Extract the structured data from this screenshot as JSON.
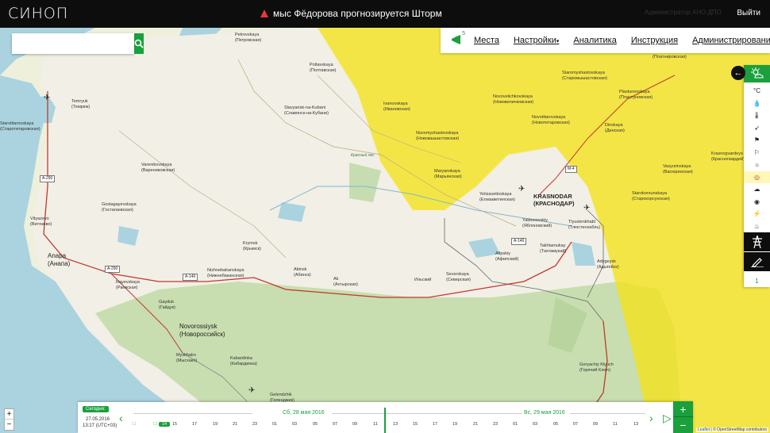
{
  "app": {
    "logo": "СИНОП",
    "alert_text": "мыс Фёдорова прогнозируется Шторм",
    "ghost_text": "Администратор АНО ДПО",
    "logout_label": "Выйти"
  },
  "search": {
    "placeholder": ""
  },
  "nav": {
    "notif_count": "5",
    "items": [
      "Места",
      "Настройки",
      "Аналитика",
      "Инструкция",
      "Администрирование"
    ],
    "dropdown_caret": "▾"
  },
  "panel": {
    "back_icon": "←",
    "number": "1",
    "items": [
      "°C",
      "💧",
      "🌡",
      "➶",
      "⚑",
      "⚐",
      "☼",
      "◎",
      "☁",
      "◉",
      "⚡",
      "♨"
    ]
  },
  "zoom": {
    "in": "+",
    "out": "−"
  },
  "timeline": {
    "today_label": "Сегодня:",
    "today_date": "27.05.2016",
    "today_time": "13:27 (UTC+03)",
    "day1": "Сб, 28 мая 2016",
    "day2": "Вс, 29 мая 2016",
    "prev": "‹",
    "next": "›",
    "play": "▷",
    "zoom_in": "+",
    "zoom_out": "−",
    "hours_dim": [
      "11",
      "13"
    ],
    "hour_now": "14",
    "hours": [
      "15",
      "17",
      "19",
      "21",
      "23",
      "01",
      "03",
      "05",
      "07",
      "09",
      "11",
      "13",
      "15",
      "17",
      "19",
      "21",
      "23",
      "01",
      "03",
      "05",
      "07",
      "09",
      "11",
      "13",
      "15"
    ]
  },
  "map": {
    "places": [
      {
        "t": "Petrovskaya\n(Петровская)",
        "c": "place"
      },
      {
        "t": "Poltavskaya\n(Полтавская)",
        "c": "place"
      },
      {
        "t": "Temryuk\n(Темрюк)",
        "c": "place"
      },
      {
        "t": "Slavyansk-na-Kubani\n(Славянск-на-Кубани)",
        "c": "place"
      },
      {
        "t": "Starotitarovskaya\n(Старотитаровская)",
        "c": "place"
      },
      {
        "t": "Varenikovskaya\n(Варениковская)",
        "c": "place"
      },
      {
        "t": "Gostagayevskaya\n(Гостагаевская)",
        "c": "place"
      },
      {
        "t": "Vityazevo\n(Витязево)",
        "c": "place"
      },
      {
        "t": "Anapa\n(Анапа)",
        "c": "place mid"
      },
      {
        "t": "Krymsk\n(Крымск)",
        "c": "place"
      },
      {
        "t": "Nizhnebakanskaya\n(Нижнебаканская)",
        "c": "place"
      },
      {
        "t": "Abinsk\n(Абинск)",
        "c": "place"
      },
      {
        "t": "Ak\n(Ахтырская)",
        "c": "place"
      },
      {
        "t": "Ильский",
        "c": "place"
      },
      {
        "t": "Severskaya\n(Северская)",
        "c": "place"
      },
      {
        "t": "Rayevskaya\n(Раевская)",
        "c": "place"
      },
      {
        "t": "Gayduk\n(Гайдук)",
        "c": "place"
      },
      {
        "t": "Novorossiysk\n(Новороссийск)",
        "c": "place mid"
      },
      {
        "t": "Myskhako\n(Мысхако)",
        "c": "place"
      },
      {
        "t": "Kabardinka\n(Кабардинка)",
        "c": "place"
      },
      {
        "t": "Gelendzhik\n(Геленджик)",
        "c": "place"
      },
      {
        "t": "Ivanovskaya\n(Ивановская)",
        "c": "place"
      },
      {
        "t": "Novomyshastovskaya\n(Новомышастовская)",
        "c": "place"
      },
      {
        "t": "Maryanskaya\n(Марьянская)",
        "c": "place"
      },
      {
        "t": "Красный лес",
        "c": "place sea"
      },
      {
        "t": "Yelizavetinskaya\n(Елизаветинская)",
        "c": "place"
      },
      {
        "t": "KRASNODAR\n(КРАСНОДАР)",
        "c": "place big"
      },
      {
        "t": "Yablonovskiy\n(Яблоновский)",
        "c": "place"
      },
      {
        "t": "Tlyustenkhabl\n(Тлюстенхабль)",
        "c": "place"
      },
      {
        "t": "Takhtamukay\n(Тахтамукай)",
        "c": "place"
      },
      {
        "t": "Afipskiy\n(Афипский)",
        "c": "place"
      },
      {
        "t": "Adygeysk\n(Адыгейск)",
        "c": "place"
      },
      {
        "t": "Goryachiy Klyuch\n(Горячий Ключ)",
        "c": "place"
      },
      {
        "t": "Novovelichkovskaya\n(Нововеличковская)",
        "c": "place"
      },
      {
        "t": "Novotitarovskaya\n(Новотитаровская)",
        "c": "place"
      },
      {
        "t": "Staromyshastovskaya\n(Старомышастовская)",
        "c": "place"
      },
      {
        "t": "Plastunovskaya\n(Пластуновская)",
        "c": "place"
      },
      {
        "t": "Dinskaya\n(Динская)",
        "c": "place"
      },
      {
        "t": "Vasyurinskaya\n(Васюринская)",
        "c": "place"
      },
      {
        "t": "Krasnogvardeys\n(Красногвардей)",
        "c": "place"
      },
      {
        "t": "Starokorsunskaya\n(Старокорсунская)",
        "c": "place"
      },
      {
        "t": "(Платнировская)",
        "c": "place"
      }
    ],
    "roads": [
      "A-290",
      "A-290",
      "A-146",
      "A-146",
      "M-4"
    ],
    "attribution_prefix": "Leaflet",
    "attribution_text": " | © OpenStreetMap contributors"
  }
}
